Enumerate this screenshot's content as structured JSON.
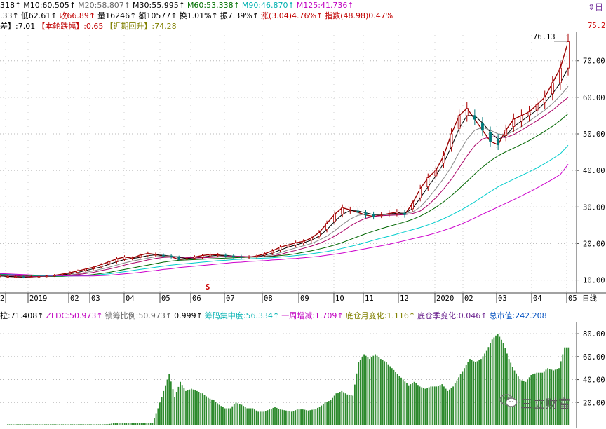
{
  "header_line1": [
    {
      "text": "318↑",
      "color": "#000000"
    },
    {
      "text": "M10:60.505↑",
      "color": "#000000"
    },
    {
      "text": "M20:58.807↑",
      "color": "#666666"
    },
    {
      "text": "M30:55.995↑",
      "color": "#000000"
    },
    {
      "text": "M60:53.338↑",
      "color": "#007000"
    },
    {
      "text": "M90:46.870↑",
      "color": "#00b0b0"
    },
    {
      "text": "M125:41.736↑",
      "color": "#c000c0"
    }
  ],
  "header_line2": [
    {
      "text": ".33↑",
      "color": "#000000"
    },
    {
      "text": "低62.61↑",
      "color": "#000000"
    },
    {
      "text": "收66.89↑",
      "color": "#c00000"
    },
    {
      "text": "量16246↑",
      "color": "#000000"
    },
    {
      "text": "额10577↑",
      "color": "#000000"
    },
    {
      "text": "换1.01%↑",
      "color": "#000000"
    },
    {
      "text": "振7.39%↑",
      "color": "#000000"
    },
    {
      "text": "涨(3.04)4.76%↑",
      "color": "#c00000"
    },
    {
      "text": "指数(48.98)0.47%",
      "color": "#c00000"
    }
  ],
  "header_line3": [
    {
      "text": "差】:7.01",
      "color": "#000000"
    },
    {
      "text": "【本轮跌幅】:0.65",
      "color": "#c00000"
    },
    {
      "text": "【近期回升】:74.28",
      "color": "#808000"
    }
  ],
  "sub_header": [
    {
      "text": "拉:71.408↑",
      "color": "#000000"
    },
    {
      "text": "ZLDC:50.973↑",
      "color": "#c000c0"
    },
    {
      "text": "锁筹比例:50.973↑",
      "color": "#666666"
    },
    {
      "text": "0.999↑",
      "color": "#000000"
    },
    {
      "text": "筹码集中度:56.334↑",
      "color": "#00b0b0"
    },
    {
      "text": "一周增减:1.709↑",
      "color": "#c000c0"
    },
    {
      "text": "底仓月变化:1.116↑",
      "color": "#808000"
    },
    {
      "text": "底仓季变化:0.046↑",
      "color": "#6b238e"
    },
    {
      "text": "总市值:242.208",
      "color": "#0050c0"
    }
  ],
  "corner_icons": "⇕日",
  "period_label": "日线",
  "signal_marker": "S",
  "watermark": "三立财富",
  "chart_data": [
    {
      "type": "line",
      "title": "",
      "y_tick_labels": [
        "10.00",
        "20.00",
        "30.00",
        "40.00",
        "50.00",
        "60.00",
        "70.00"
      ],
      "ylim": [
        8,
        78
      ],
      "price_labels": {
        "high": "76.13",
        "last": "75.22"
      },
      "x_tick_labels": [
        "2",
        "2019",
        "02",
        "03",
        "04",
        "05",
        "06",
        "07",
        "08",
        "09",
        "10",
        "11",
        "12",
        "2020",
        "02",
        "03",
        "04",
        "05"
      ],
      "grid": true,
      "series": [
        {
          "name": "price",
          "color": "#990000",
          "values": [
            11.2,
            11.0,
            10.9,
            10.8,
            10.9,
            11.0,
            11.1,
            11.3,
            11.6,
            12.0,
            12.5,
            13.0,
            13.5,
            14.2,
            15.0,
            15.8,
            16.3,
            16.0,
            16.8,
            17.3,
            17.0,
            16.6,
            16.4,
            15.6,
            15.9,
            16.3,
            16.7,
            17.0,
            16.9,
            16.6,
            16.4,
            16.2,
            16.3,
            16.6,
            17.2,
            18.0,
            19.0,
            19.6,
            20.2,
            20.6,
            21.5,
            23.0,
            25.5,
            28.0,
            29.8,
            29.2,
            28.5,
            27.8,
            27.4,
            27.8,
            28.2,
            28.6,
            27.9,
            31.0,
            35.0,
            38.0,
            40.0,
            44.0,
            50.0,
            55.0,
            57.0,
            54.0,
            51.0,
            48.0,
            47.0,
            51.0,
            54.0,
            55.0,
            56.0,
            58.0,
            60.0,
            64.0,
            68.0,
            75.2
          ]
        },
        {
          "name": "M10",
          "color": "#000000",
          "values": [
            11.1,
            11.0,
            10.9,
            10.9,
            10.9,
            11.0,
            11.1,
            11.2,
            11.4,
            11.7,
            12.1,
            12.6,
            13.1,
            13.6,
            14.3,
            15.0,
            15.6,
            15.9,
            16.2,
            16.7,
            16.9,
            16.8,
            16.6,
            16.2,
            15.9,
            16.0,
            16.3,
            16.6,
            16.8,
            16.8,
            16.6,
            16.4,
            16.3,
            16.4,
            16.8,
            17.4,
            18.2,
            19.0,
            19.6,
            20.2,
            20.9,
            22.0,
            23.8,
            26.0,
            28.0,
            29.0,
            28.9,
            28.4,
            27.9,
            27.8,
            28.0,
            28.3,
            28.3,
            29.5,
            32.5,
            35.5,
            38.5,
            42.0,
            46.5,
            51.5,
            55.0,
            55.0,
            53.0,
            50.5,
            48.5,
            49.5,
            52.0,
            53.5,
            55.0,
            56.5,
            58.5,
            61.0,
            64.0,
            68.0
          ]
        },
        {
          "name": "M20",
          "color": "#888888",
          "values": [
            11.3,
            11.2,
            11.1,
            11.0,
            11.0,
            11.0,
            11.0,
            11.1,
            11.2,
            11.4,
            11.7,
            12.1,
            12.5,
            13.0,
            13.5,
            14.1,
            14.7,
            15.2,
            15.6,
            16.0,
            16.4,
            16.6,
            16.6,
            16.4,
            16.2,
            16.0,
            16.1,
            16.3,
            16.5,
            16.6,
            16.6,
            16.5,
            16.4,
            16.4,
            16.5,
            16.9,
            17.5,
            18.2,
            18.8,
            19.4,
            20.0,
            20.9,
            22.0,
            23.5,
            25.2,
            26.7,
            27.7,
            28.1,
            28.0,
            27.9,
            27.9,
            28.0,
            28.2,
            28.6,
            30.0,
            32.3,
            35.0,
            37.8,
            41.0,
            45.0,
            48.5,
            51.0,
            51.8,
            51.0,
            50.0,
            49.7,
            50.8,
            52.0,
            53.5,
            55.0,
            56.5,
            58.3,
            60.5,
            63.0
          ]
        },
        {
          "name": "M30",
          "color": "#aa0066",
          "values": [
            11.4,
            11.3,
            11.2,
            11.1,
            11.0,
            11.0,
            11.0,
            11.0,
            11.1,
            11.3,
            11.5,
            11.8,
            12.1,
            12.6,
            13.0,
            13.5,
            14.1,
            14.6,
            15.0,
            15.5,
            15.9,
            16.2,
            16.3,
            16.3,
            16.2,
            16.1,
            16.1,
            16.2,
            16.3,
            16.5,
            16.5,
            16.5,
            16.4,
            16.4,
            16.4,
            16.6,
            17.0,
            17.6,
            18.1,
            18.7,
            19.3,
            20.0,
            20.9,
            22.0,
            23.3,
            24.8,
            26.0,
            26.9,
            27.4,
            27.6,
            27.7,
            27.8,
            27.9,
            28.2,
            28.9,
            30.5,
            32.5,
            34.9,
            37.6,
            40.8,
            44.0,
            46.8,
            48.6,
            49.2,
            49.2,
            49.0,
            49.8,
            51.0,
            52.3,
            53.6,
            55.0,
            56.5,
            58.3,
            60.0
          ]
        },
        {
          "name": "M60",
          "color": "#006600",
          "values": [
            11.6,
            11.5,
            11.4,
            11.3,
            11.2,
            11.1,
            11.1,
            11.0,
            11.0,
            11.1,
            11.2,
            11.3,
            11.5,
            11.8,
            12.1,
            12.5,
            12.9,
            13.3,
            13.7,
            14.1,
            14.5,
            14.9,
            15.2,
            15.4,
            15.5,
            15.6,
            15.7,
            15.8,
            15.9,
            16.0,
            16.1,
            16.2,
            16.3,
            16.3,
            16.4,
            16.5,
            16.7,
            16.9,
            17.2,
            17.6,
            18.0,
            18.5,
            19.0,
            19.6,
            20.3,
            21.1,
            21.9,
            22.7,
            23.4,
            24.1,
            24.7,
            25.3,
            25.9,
            26.6,
            27.5,
            28.6,
            29.9,
            31.4,
            33.1,
            35.0,
            37.0,
            39.0,
            40.9,
            42.6,
            44.0,
            45.1,
            46.1,
            47.1,
            48.2,
            49.4,
            50.7,
            52.1,
            53.7,
            55.5
          ]
        },
        {
          "name": "M90",
          "color": "#00cccc",
          "values": [
            11.7,
            11.6,
            11.5,
            11.4,
            11.3,
            11.2,
            11.2,
            11.1,
            11.1,
            11.1,
            11.1,
            11.2,
            11.3,
            11.5,
            11.7,
            12.0,
            12.3,
            12.6,
            12.9,
            13.2,
            13.5,
            13.8,
            14.1,
            14.3,
            14.5,
            14.7,
            14.9,
            15.1,
            15.3,
            15.4,
            15.6,
            15.7,
            15.8,
            15.9,
            16.0,
            16.1,
            16.3,
            16.5,
            16.7,
            16.9,
            17.2,
            17.5,
            17.8,
            18.2,
            18.7,
            19.2,
            19.7,
            20.3,
            20.9,
            21.5,
            22.0,
            22.6,
            23.2,
            23.8,
            24.4,
            25.1,
            25.9,
            26.8,
            27.8,
            28.9,
            30.1,
            31.4,
            32.8,
            34.2,
            35.5,
            36.6,
            37.6,
            38.6,
            39.6,
            40.7,
            41.9,
            43.2,
            44.6,
            46.9
          ]
        },
        {
          "name": "M125",
          "color": "#cc00cc",
          "values": [
            11.8,
            11.7,
            11.6,
            11.5,
            11.4,
            11.3,
            11.3,
            11.2,
            11.2,
            11.1,
            11.1,
            11.1,
            11.1,
            11.2,
            11.3,
            11.5,
            11.7,
            11.9,
            12.1,
            12.4,
            12.6,
            12.9,
            13.1,
            13.4,
            13.6,
            13.8,
            14.0,
            14.2,
            14.4,
            14.6,
            14.8,
            14.9,
            15.1,
            15.2,
            15.3,
            15.5,
            15.6,
            15.8,
            15.9,
            16.1,
            16.3,
            16.5,
            16.8,
            17.1,
            17.4,
            17.8,
            18.2,
            18.6,
            19.0,
            19.4,
            19.8,
            20.3,
            20.8,
            21.3,
            21.8,
            22.3,
            22.9,
            23.6,
            24.3,
            25.1,
            26.0,
            27.0,
            28.0,
            29.0,
            30.0,
            31.0,
            32.0,
            33.0,
            34.1,
            35.2,
            36.4,
            37.6,
            38.9,
            41.7
          ]
        }
      ]
    },
    {
      "type": "bar",
      "title": "",
      "y_tick_labels": [
        "20.00",
        "40.00",
        "60.00",
        "80.00"
      ],
      "ylim": [
        0,
        88
      ],
      "series": [
        {
          "name": "",
          "color": "#2d8a2d",
          "values": [
            1,
            1,
            1,
            1,
            1,
            1,
            1,
            1,
            1,
            1,
            1,
            1,
            1,
            1,
            1,
            1,
            1,
            1,
            1,
            2,
            2,
            2,
            2,
            2,
            2,
            2,
            2,
            15,
            30,
            45,
            25,
            38,
            30,
            32,
            30,
            28,
            24,
            22,
            18,
            15,
            15,
            20,
            18,
            15,
            15,
            12,
            12,
            14,
            16,
            14,
            13,
            12,
            14,
            14,
            13,
            14,
            16,
            20,
            22,
            28,
            30,
            27,
            26,
            55,
            62,
            58,
            62,
            58,
            55,
            50,
            45,
            40,
            35,
            38,
            34,
            32,
            34,
            34,
            36,
            30,
            34,
            42,
            50,
            58,
            55,
            58,
            65,
            75,
            80,
            72,
            58,
            48,
            40,
            38,
            44,
            46,
            46,
            50,
            48,
            50,
            68
          ]
        }
      ]
    }
  ]
}
